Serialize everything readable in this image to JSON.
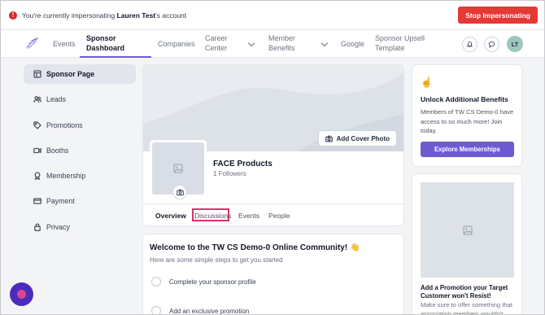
{
  "banner": {
    "message_prefix": "You're currently impersonating ",
    "user_name": "Lauren Test",
    "message_suffix": "'s account",
    "stop_label": "Stop Impersonating"
  },
  "nav": {
    "items": [
      {
        "label": "Events"
      },
      {
        "label": "Sponsor Dashboard"
      },
      {
        "label": "Companies"
      },
      {
        "label": "Career Center"
      },
      {
        "label": "Member Benefits"
      },
      {
        "label": "Google"
      },
      {
        "label": "Sponsor Upsell Template"
      }
    ],
    "active": "Sponsor Dashboard",
    "avatar_initials": "LT"
  },
  "sidebar": {
    "items": [
      {
        "label": "Sponsor Page",
        "icon": "layout-icon",
        "active": true
      },
      {
        "label": "Leads",
        "icon": "users-icon"
      },
      {
        "label": "Promotions",
        "icon": "tag-icon"
      },
      {
        "label": "Booths",
        "icon": "video-icon"
      },
      {
        "label": "Membership",
        "icon": "award-icon"
      },
      {
        "label": "Payment",
        "icon": "credit-card-icon"
      },
      {
        "label": "Privacy",
        "icon": "lock-icon"
      }
    ]
  },
  "profile": {
    "add_cover_label": "Add Cover Photo",
    "company_name": "FACE Products",
    "followers": "1 Followers",
    "tabs": [
      {
        "label": "Overview",
        "active": true
      },
      {
        "label": "Discussions",
        "highlighted": true
      },
      {
        "label": "Events"
      },
      {
        "label": "People"
      }
    ]
  },
  "welcome": {
    "title": "Welcome to the TW CS Demo-0 Online Community! 👋",
    "subtitle": "Here are some simple steps to get you started",
    "steps": [
      {
        "label": "Complete your sponsor profile"
      },
      {
        "label": "Add an exclusive promotion"
      }
    ]
  },
  "benefits": {
    "emoji": "☝️",
    "title": "Unlock Additional Benefits",
    "text": "Members of TW CS Demo-0 have access to so much more! Join today.",
    "button_label": "Explore Memberships"
  },
  "promo": {
    "title": "Add a Promotion your Target Customer won't Resist!",
    "text": "Make sure to offer something that association members wouldn't"
  },
  "colors": {
    "accent": "#6d5bd0",
    "danger": "#e53935",
    "highlight": "#d6336c"
  }
}
